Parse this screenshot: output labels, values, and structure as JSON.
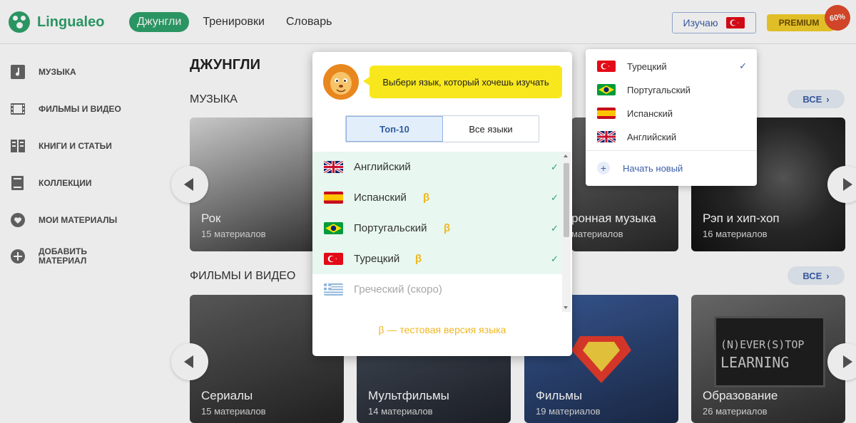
{
  "header": {
    "logo_text": "Lingualeo",
    "nav": [
      {
        "label": "Джунгли",
        "active": true
      },
      {
        "label": "Тренировки",
        "active": false
      },
      {
        "label": "Словарь",
        "active": false
      }
    ],
    "learning_label": "Изучаю",
    "learning_flag": "turkey-flag",
    "premium_label": "PREMIUM",
    "premium_badge": "60%"
  },
  "sidebar": {
    "items": [
      {
        "label": "МУЗЫКА",
        "icon": "music-icon"
      },
      {
        "label": "ФИЛЬМЫ И ВИДЕО",
        "icon": "film-icon"
      },
      {
        "label": "КНИГИ И СТАТЬИ",
        "icon": "book-icon"
      },
      {
        "label": "КОЛЛЕКЦИИ",
        "icon": "collection-icon"
      },
      {
        "label": "МОИ МАТЕРИАЛЫ",
        "icon": "heart-icon"
      },
      {
        "label": "ДОБАВИТЬ",
        "label2": "МАТЕРИАЛ",
        "icon": "plus-icon"
      }
    ]
  },
  "main": {
    "title": "ДЖУНГЛИ",
    "sections": [
      {
        "title": "МУЗЫКА",
        "all_label": "ВСЕ",
        "cards": [
          {
            "title": "Рок",
            "subtitle": "15 материалов"
          },
          {
            "title": "ронная музыка",
            "subtitle": "материалов"
          },
          {
            "title": "Рэп и хип-хоп",
            "subtitle": "16 материалов"
          }
        ]
      },
      {
        "title": "ФИЛЬМЫ И ВИДЕО",
        "all_label": "ВСЕ",
        "cards": [
          {
            "title": "Сериалы",
            "subtitle": "15 материалов"
          },
          {
            "title": "Мультфильмы",
            "subtitle": "14 материалов"
          },
          {
            "title": "Фильмы",
            "subtitle": "19 материалов"
          },
          {
            "title": "Образование",
            "subtitle": "26 материалов"
          }
        ]
      }
    ],
    "education_card_text": [
      "(N)EVER(S)TOP",
      "LEARNING"
    ]
  },
  "dropdown": {
    "items": [
      {
        "label": "Турецкий",
        "flag": "turkey-flag",
        "checked": true
      },
      {
        "label": "Португальский",
        "flag": "brazil-flag",
        "checked": false
      },
      {
        "label": "Испанский",
        "flag": "spain-flag",
        "checked": false
      },
      {
        "label": "Английский",
        "flag": "uk-flag",
        "checked": false
      }
    ],
    "new_label": "Начать новый"
  },
  "modal": {
    "prompt": "Выбери язык, который хочешь изучать",
    "tabs": [
      {
        "label": "Топ-10",
        "active": true
      },
      {
        "label": "Все языки",
        "active": false
      }
    ],
    "languages": [
      {
        "label": "Английский",
        "flag": "uk-flag",
        "beta": "",
        "selected": true
      },
      {
        "label": "Испанский",
        "flag": "spain-flag",
        "beta": "β",
        "selected": true
      },
      {
        "label": "Португальский",
        "flag": "brazil-flag",
        "beta": "β",
        "selected": true
      },
      {
        "label": "Турецкий",
        "flag": "turkey-flag",
        "beta": "β",
        "selected": true
      },
      {
        "label": "Греческий (скоро)",
        "flag": "greece-flag",
        "beta": "",
        "selected": false
      }
    ],
    "check_mark": "✓",
    "footnote": "β — тестовая версия языка"
  },
  "colors": {
    "brand_green": "#2ea26b",
    "accent_blue": "#3b5ea8",
    "prompt_yellow": "#f8e71c",
    "beta_orange": "#f0b820",
    "selected_row_bg": "#e8f7ef"
  }
}
